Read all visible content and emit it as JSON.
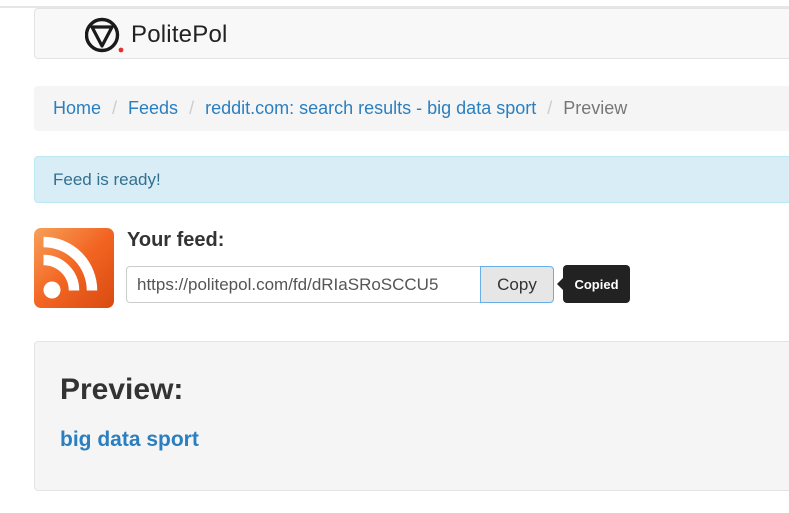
{
  "navbar": {
    "brand_name": "PolitePol",
    "logo_icon": "triangle-in-circle-logo-icon"
  },
  "breadcrumb": {
    "home": "Home",
    "separator": "/",
    "feeds": "Feeds",
    "source": "reddit.com: search results - big data sport",
    "current": "Preview"
  },
  "alert": {
    "message": "Feed is ready!"
  },
  "feed": {
    "label": "Your feed:",
    "url": "https://politepol.com/fd/dRIaSRoSCCU5",
    "copy_label": "Copy",
    "tooltip": "Copied",
    "icon": "rss-icon"
  },
  "preview": {
    "title": "Preview:",
    "item_link": "big data sport"
  },
  "colors": {
    "link": "#2a7fc0",
    "alert_bg": "#d9edf7",
    "alert_text": "#31708f",
    "rss_orange": "#f26522",
    "logo_dot": "#e8312f"
  }
}
